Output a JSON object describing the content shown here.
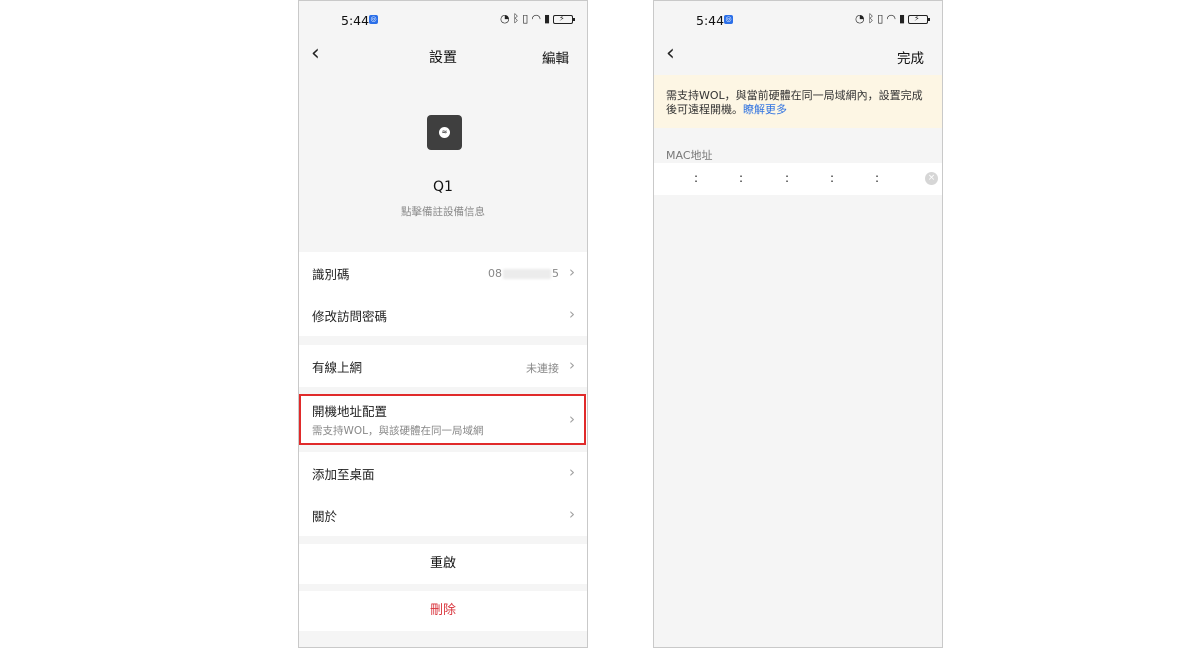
{
  "status": {
    "time": "5:44",
    "app_badge": "◎",
    "icons": [
      "speedometer-icon",
      "bluetooth-icon",
      "vibrate-icon",
      "wifi-icon",
      "battery-saver-icon",
      "battery-icon"
    ],
    "signal_glyphs": {
      "speed": "◔",
      "bt": "ᛒ",
      "vib": "▯",
      "wifi": "◠",
      "saver": "▮",
      "bolt": "⚡"
    }
  },
  "left": {
    "nav": {
      "back": "‹",
      "title": "設置",
      "action": "編輯"
    },
    "device": {
      "glyph": "≈",
      "name": "Q1",
      "hint": "點擊備註設備信息"
    },
    "rows": {
      "id_label": "識別碼",
      "id_prefix": "08",
      "id_suffix": "5",
      "password_label": "修改訪問密碼",
      "wired_label": "有線上網",
      "wired_value": "未連接",
      "boot_label": "開機地址配置",
      "boot_sub": "需支持WOL，與該硬體在同一局域網",
      "desktop_label": "添加至桌面",
      "about_label": "關於"
    },
    "chevron": "›",
    "restart": "重啟",
    "delete": "刪除"
  },
  "right": {
    "nav": {
      "back": "‹",
      "action": "完成"
    },
    "banner": {
      "text": "需支持WOL，與當前硬體在同一局域網內，設置完成後可遠程開機。",
      "link": "瞭解更多"
    },
    "mac": {
      "label": "MAC地址",
      "separator": ":",
      "clear": "×"
    }
  },
  "colors": {
    "highlight": "#e02a2a",
    "delete": "#d9343c",
    "link": "#2f72e0",
    "banner_bg": "#fdf6e4"
  }
}
